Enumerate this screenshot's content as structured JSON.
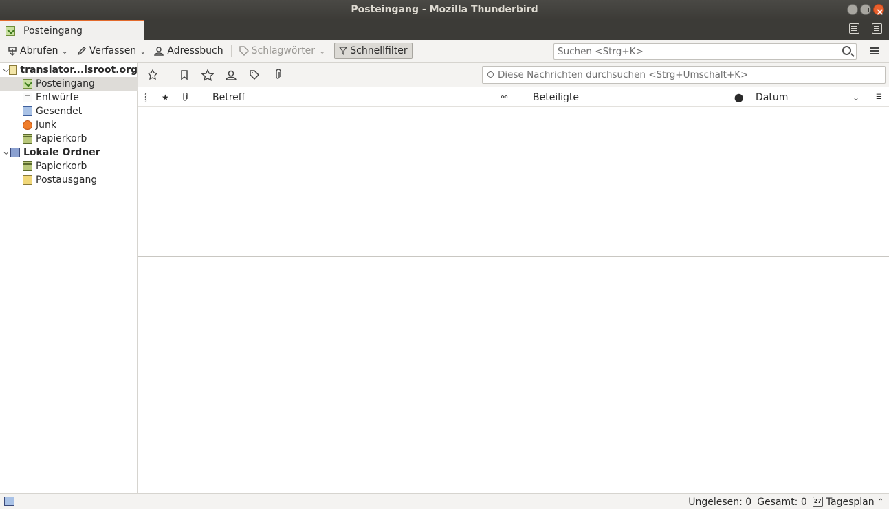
{
  "window": {
    "title": "Posteingang - Mozilla Thunderbird"
  },
  "tabs": [
    {
      "label": "Posteingang"
    }
  ],
  "toolbar": {
    "get_messages": "Abrufen",
    "compose": "Verfassen",
    "address_book": "Adressbuch",
    "tags": "Schlagwörter",
    "quick_filter": "Schnellfilter",
    "search_placeholder": "Suchen <Strg+K>"
  },
  "folders": {
    "account": "translator...isroot.org",
    "account_folders": [
      "Posteingang",
      "Entwürfe",
      "Gesendet",
      "Junk",
      "Papierkorb"
    ],
    "local": "Lokale Ordner",
    "local_folders": [
      "Papierkorb",
      "Postausgang"
    ]
  },
  "filter": {
    "search_placeholder": "Diese Nachrichten durchsuchen <Strg+Umschalt+K>"
  },
  "columns": {
    "subject": "Betreff",
    "correspondents": "Beteiligte",
    "date": "Datum"
  },
  "status": {
    "unread": "Ungelesen: 0",
    "total": "Gesamt: 0",
    "today_pane": "Tagesplan",
    "calendar_day": "27"
  },
  "colors": {
    "accent_tab": "#e36a2c",
    "titlebar": "#3c3b37",
    "selection": "#dedcd8"
  }
}
